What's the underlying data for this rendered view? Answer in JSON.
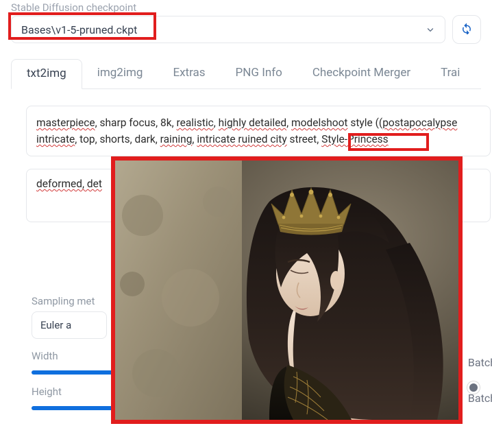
{
  "checkpoint": {
    "label": "Stable Diffusion checkpoint",
    "value": "Bases\\v1-5-pruned.ckpt"
  },
  "tabs": [
    {
      "label": "txt2img",
      "active": true
    },
    {
      "label": "img2img",
      "active": false
    },
    {
      "label": "Extras",
      "active": false
    },
    {
      "label": "PNG Info",
      "active": false
    },
    {
      "label": "Checkpoint Merger",
      "active": false
    },
    {
      "label": "Trai",
      "active": false
    }
  ],
  "prompt": {
    "words": [
      "masterpiece",
      ", sharp focus, 8k, ",
      "realistic",
      ", ",
      "highly detailed",
      ", ",
      "modelshoot",
      " style ((",
      "postapocalypse",
      "intricate",
      ", top, shorts, dark, ",
      "raining",
      ", ",
      "intricate ruined city",
      " street,"
    ],
    "emphasis": "Style-Princess"
  },
  "neg_prompt": "deformed, det",
  "sampling": {
    "label": "Sampling met",
    "value": "Euler a"
  },
  "width": {
    "label": "Width",
    "right": "Batch"
  },
  "height": {
    "label": "Height",
    "right": "Batch"
  }
}
